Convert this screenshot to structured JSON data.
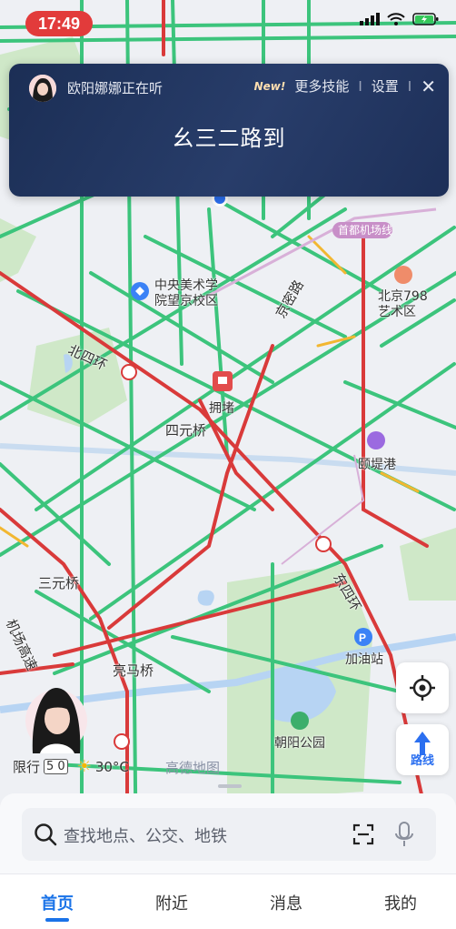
{
  "status_bar": {
    "time": "17:49"
  },
  "assistant": {
    "listening_text": "欧阳娜娜正在听",
    "new_badge": "New!",
    "more_skills": "更多技能",
    "divider": "I",
    "settings": "设置",
    "recognized_text": "幺三二路到"
  },
  "map_labels": {
    "airport_line": "首都机场线",
    "academy": "中央美术学\n院望京校区",
    "jingmi_road": "京密路",
    "art_district": "北京798\n艺术区",
    "north_4th_ring": "北四环",
    "congestion": "拥堵",
    "siyuan_bridge": "四元桥",
    "yidi_port": "颐堤港",
    "sanyuan_bridge": "三元桥",
    "east_4th_ring": "东四环",
    "airport_expressway": "机场高速",
    "gas_station": "加油站",
    "liangma_bridge": "亮马桥",
    "chaoyang_park": "朝阳公园"
  },
  "map_controls": {
    "route_label": "路线"
  },
  "bottom_info": {
    "restriction_label": "限行",
    "restriction_numbers": "5 0",
    "temperature": "30°C",
    "map_logo": "高德地图"
  },
  "search": {
    "placeholder": "查找地点、公交、地铁"
  },
  "tabs": [
    {
      "label": "首页"
    },
    {
      "label": "附近"
    },
    {
      "label": "消息"
    },
    {
      "label": "我的"
    }
  ],
  "colors": {
    "accent": "#1a73e8",
    "time_pill": "#e23b3b",
    "assistant_bg": "#1f3360",
    "traffic_green": "#3cc47c",
    "traffic_red": "#d93a3a",
    "traffic_yellow": "#f2b731"
  }
}
